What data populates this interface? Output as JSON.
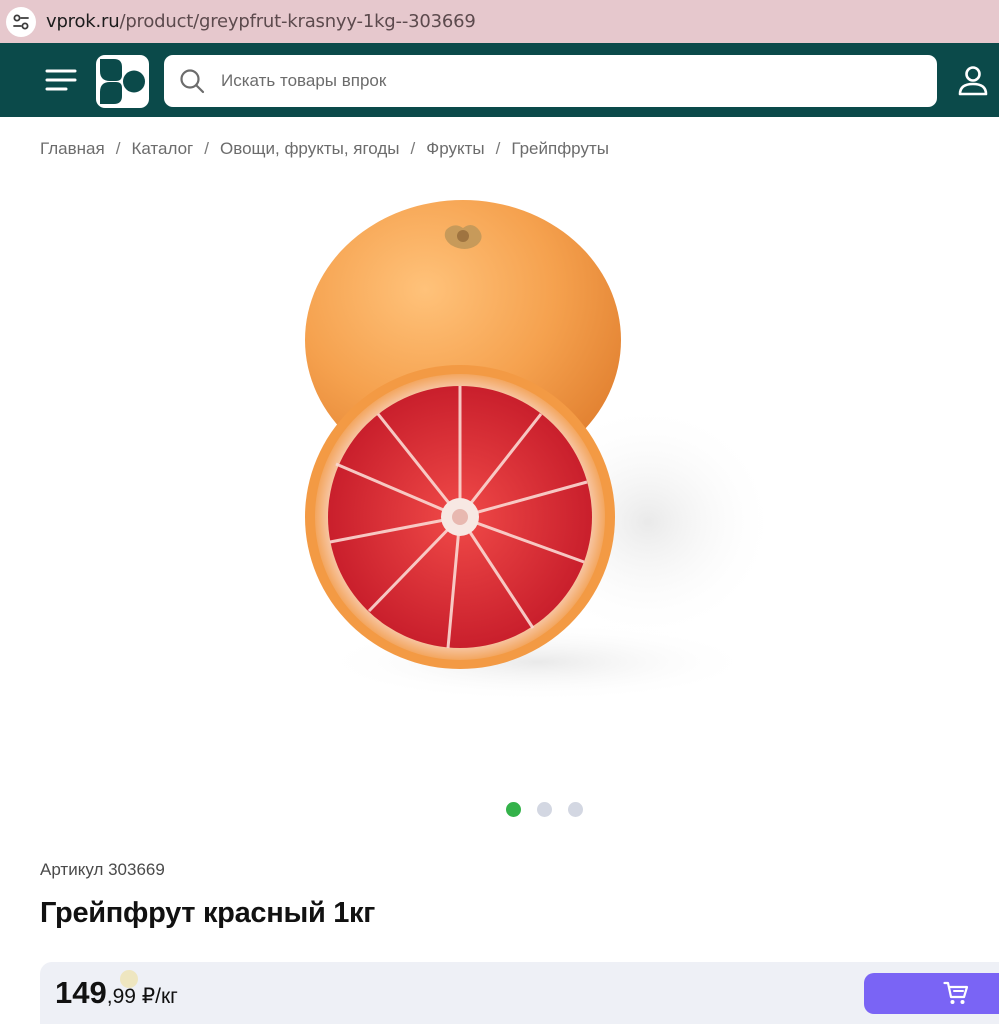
{
  "browser": {
    "url_host": "vprok.ru",
    "url_path": "/product/greypfrut-krasnyy-1kg--303669"
  },
  "header": {
    "search_placeholder": "Искать товары впрок"
  },
  "breadcrumbs": [
    "Главная",
    "Каталог",
    "Овощи, фрукты, ягоды",
    "Фрукты",
    "Грейпфруты"
  ],
  "breadcrumb_separator": "/",
  "gallery": {
    "image_count": 3,
    "active_index": 0
  },
  "product": {
    "sku_label": "Артикул 303669",
    "title": "Грейпфрут красный 1кг",
    "price_main": "149",
    "price_fraction": ",99 ₽/кг"
  },
  "colors": {
    "header_bg": "#0b4a4a",
    "cart_button": "#7a64f5",
    "active_dot": "#34b24a",
    "urlbar_bg": "#e6c8cd"
  },
  "icons": [
    "site-settings-icon",
    "menu-icon",
    "logo-icon",
    "search-icon",
    "profile-icon",
    "cart-icon"
  ]
}
